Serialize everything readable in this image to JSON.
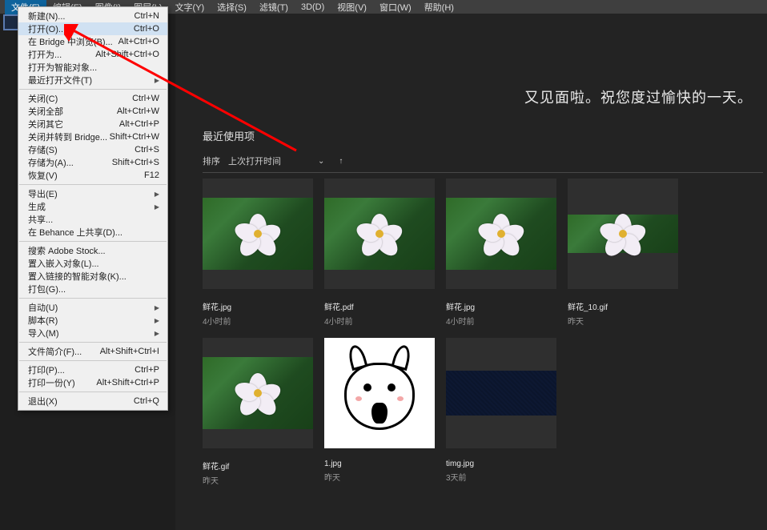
{
  "menubar": [
    "文件(F)",
    "编辑(E)",
    "图像(I)",
    "图层(L)",
    "文字(Y)",
    "选择(S)",
    "滤镜(T)",
    "3D(D)",
    "视图(V)",
    "窗口(W)",
    "帮助(H)"
  ],
  "dropdown": [
    {
      "label": "新建(N)...",
      "accel": "Ctrl+N"
    },
    {
      "label": "打开(O)...",
      "accel": "Ctrl+O",
      "hl": true
    },
    {
      "label": "在 Bridge 中浏览(B)...",
      "accel": "Alt+Ctrl+O"
    },
    {
      "label": "打开为...",
      "accel": "Alt+Shift+Ctrl+O"
    },
    {
      "label": "打开为智能对象..."
    },
    {
      "label": "最近打开文件(T)",
      "sub": true
    },
    {
      "sep": true
    },
    {
      "label": "关闭(C)",
      "accel": "Ctrl+W"
    },
    {
      "label": "关闭全部",
      "accel": "Alt+Ctrl+W"
    },
    {
      "label": "关闭其它",
      "accel": "Alt+Ctrl+P"
    },
    {
      "label": "关闭并转到 Bridge...",
      "accel": "Shift+Ctrl+W"
    },
    {
      "label": "存储(S)",
      "accel": "Ctrl+S"
    },
    {
      "label": "存储为(A)...",
      "accel": "Shift+Ctrl+S"
    },
    {
      "label": "恢复(V)",
      "accel": "F12"
    },
    {
      "sep": true
    },
    {
      "label": "导出(E)",
      "sub": true
    },
    {
      "label": "生成",
      "sub": true
    },
    {
      "label": "共享..."
    },
    {
      "label": "在 Behance 上共享(D)..."
    },
    {
      "sep": true
    },
    {
      "label": "搜索 Adobe Stock..."
    },
    {
      "label": "置入嵌入对象(L)..."
    },
    {
      "label": "置入链接的智能对象(K)..."
    },
    {
      "label": "打包(G)..."
    },
    {
      "sep": true
    },
    {
      "label": "自动(U)",
      "sub": true
    },
    {
      "label": "脚本(R)",
      "sub": true
    },
    {
      "label": "导入(M)",
      "sub": true
    },
    {
      "sep": true
    },
    {
      "label": "文件简介(F)...",
      "accel": "Alt+Shift+Ctrl+I"
    },
    {
      "sep": true
    },
    {
      "label": "打印(P)...",
      "accel": "Ctrl+P"
    },
    {
      "label": "打印一份(Y)",
      "accel": "Alt+Shift+Ctrl+P"
    },
    {
      "sep": true
    },
    {
      "label": "退出(X)",
      "accel": "Ctrl+Q"
    }
  ],
  "greeting": "又见面啦。祝您度过愉快的一天。",
  "recents_title": "最近使用项",
  "sort": {
    "label": "排序",
    "value": "上次打开时间"
  },
  "files": [
    {
      "name": "鲜花.jpg",
      "when": "4小时前",
      "kind": "flower"
    },
    {
      "name": "鲜花.pdf",
      "when": "4小时前",
      "kind": "flower"
    },
    {
      "name": "鲜花.jpg",
      "when": "4小时前",
      "kind": "flower"
    },
    {
      "name": "鲜花_10.gif",
      "when": "昨天",
      "kind": "flower-narrow"
    },
    {
      "name": "鲜花.gif",
      "when": "昨天",
      "kind": "flower"
    },
    {
      "name": "1.jpg",
      "when": "昨天",
      "kind": "face"
    },
    {
      "name": "timg.jpg",
      "when": "3天前",
      "kind": "bluetex"
    }
  ]
}
